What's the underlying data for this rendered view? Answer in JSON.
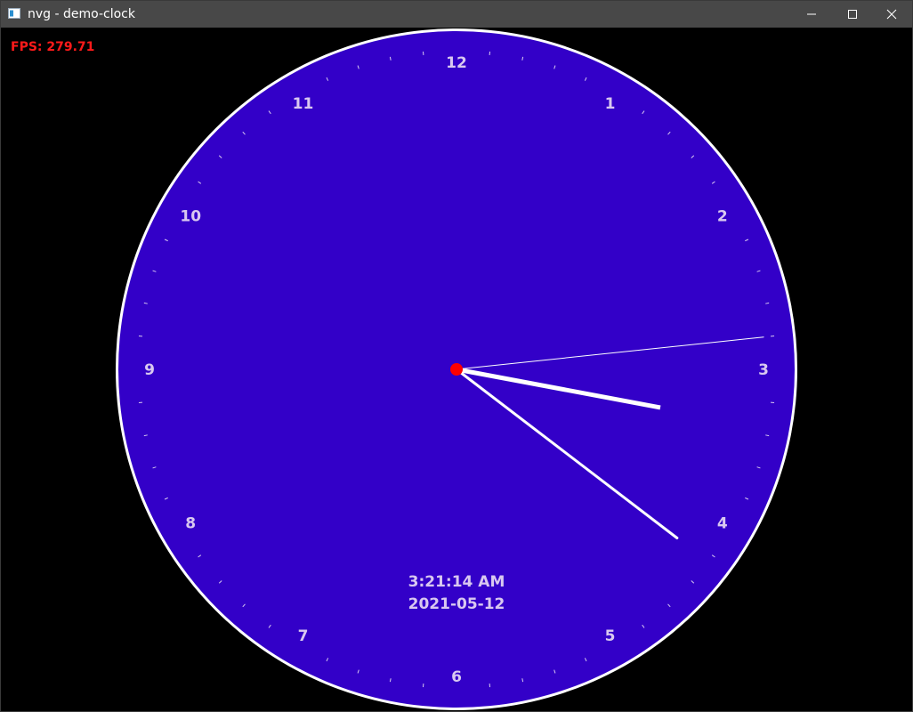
{
  "window": {
    "title": "nvg - demo-clock"
  },
  "hud": {
    "fps_text": "FPS: 279.71"
  },
  "clock": {
    "numerals": [
      "12",
      "1",
      "2",
      "3",
      "4",
      "5",
      "6",
      "7",
      "8",
      "9",
      "10",
      "11"
    ],
    "time_text": "3:21:14 AM",
    "date_text": "2021-05-12",
    "hours": 3,
    "minutes": 21,
    "seconds": 14,
    "colors": {
      "face": "#3300c8",
      "rim": "#ffffff",
      "tick": "#d9c8f0",
      "hands": "#ffffff",
      "center_dot": "#ff0000",
      "text": "#d9c8f0"
    }
  }
}
